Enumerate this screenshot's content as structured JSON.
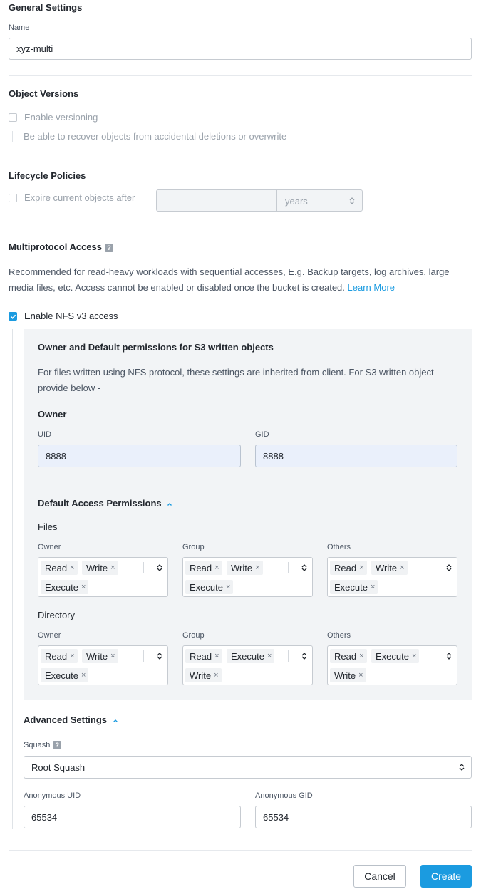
{
  "general": {
    "title": "General Settings",
    "name_label": "Name",
    "name_value": "xyz-multi"
  },
  "versions": {
    "title": "Object Versions",
    "checkbox_label": "Enable versioning",
    "description": "Be able to recover objects from accidental deletions or overwrite"
  },
  "lifecycle": {
    "title": "Lifecycle Policies",
    "checkbox_label": "Expire current objects after",
    "value": "",
    "unit": "years"
  },
  "multiprotocol": {
    "title": "Multiprotocol Access",
    "help_glyph": "?",
    "description": "Recommended for read-heavy workloads with sequential accesses, E.g. Backup targets, log archives, large media files, etc. Access cannot be enabled or disabled once the bucket is created.",
    "learn_more": "Learn More",
    "enable_label": "Enable NFS v3 access",
    "enable_checked": true
  },
  "owner_panel": {
    "title": "Owner and Default permissions for S3 written objects",
    "description": "For files written using NFS protocol, these settings are inherited from client. For S3 written object provide below -",
    "owner_heading": "Owner",
    "uid_label": "UID",
    "uid_value": "8888",
    "gid_label": "GID",
    "gid_value": "8888",
    "default_perms_heading": "Default Access Permissions",
    "files_heading": "Files",
    "directory_heading": "Directory",
    "col_owner": "Owner",
    "col_group": "Group",
    "col_others": "Others",
    "remove_glyph": "×",
    "files": {
      "owner": [
        "Read",
        "Write",
        "Execute"
      ],
      "group": [
        "Read",
        "Write",
        "Execute"
      ],
      "others": [
        "Read",
        "Write",
        "Execute"
      ]
    },
    "directory": {
      "owner": [
        "Read",
        "Write",
        "Execute"
      ],
      "group": [
        "Read",
        "Execute",
        "Write"
      ],
      "others": [
        "Read",
        "Execute",
        "Write"
      ]
    }
  },
  "advanced": {
    "title": "Advanced Settings",
    "squash_label": "Squash",
    "help_glyph": "?",
    "squash_value": "Root Squash",
    "anon_uid_label": "Anonymous UID",
    "anon_uid_value": "65534",
    "anon_gid_label": "Anonymous GID",
    "anon_gid_value": "65534"
  },
  "footer": {
    "cancel": "Cancel",
    "create": "Create"
  },
  "colors": {
    "primary": "#1b9be0",
    "panel_bg": "#f2f4f6",
    "input_filled_bg": "#eaf0fb"
  }
}
